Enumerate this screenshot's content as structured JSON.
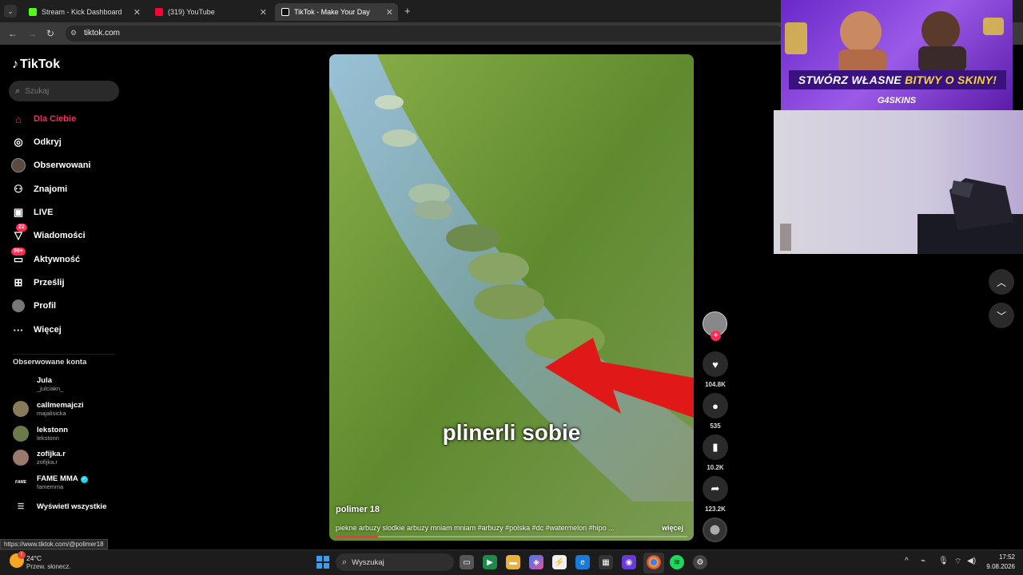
{
  "browser": {
    "tabs": [
      {
        "label": "Stream - Kick Dashboard",
        "color": "#53fc18"
      },
      {
        "label": "(319) YouTube",
        "color": "#ff0033"
      },
      {
        "label": "TikTok - Make Your Day",
        "color": "#ffffff"
      }
    ],
    "url": "tiktok.com",
    "status_url": "https://www.tiktok.com/@polimer18"
  },
  "sidebar": {
    "logo": "TikTok",
    "search_placeholder": "Szukaj",
    "nav": [
      {
        "label": "Dla Ciebie",
        "icon": "home-icon"
      },
      {
        "label": "Odkryj",
        "icon": "compass-icon"
      },
      {
        "label": "Obserwowani",
        "icon": "avatar-icon"
      },
      {
        "label": "Znajomi",
        "icon": "friends-icon"
      },
      {
        "label": "LIVE",
        "icon": "live-icon"
      },
      {
        "label": "Wiadomości",
        "icon": "send-icon",
        "badge": "22"
      },
      {
        "label": "Aktywność",
        "icon": "inbox-icon",
        "badge": "99+"
      },
      {
        "label": "Prześlij",
        "icon": "upload-icon"
      },
      {
        "label": "Profil",
        "icon": "profile-icon"
      },
      {
        "label": "Więcej",
        "icon": "more-icon"
      }
    ],
    "followed_title": "Obserwowane konta",
    "accounts": [
      {
        "name": "Jula",
        "handle": "_julciakn_"
      },
      {
        "name": "callmemajczi",
        "handle": "majalisicka"
      },
      {
        "name": "lekstonn",
        "handle": "lekstonn"
      },
      {
        "name": "zofijka.r",
        "handle": "zofijka.r"
      },
      {
        "name": "FAME MMA",
        "handle": "famemma",
        "avatar_text": "FAME"
      }
    ],
    "see_all": "Wyświetl wszystkie"
  },
  "video": {
    "overlay_text": "plinerli sobie",
    "author": "polimer 18",
    "description": "piekne arbuzy slodkie arbuzy mniam mniam #arbuzy #polska #dc #watermelon #hipo ...",
    "more": "więcej",
    "progress": 0.12
  },
  "actions": {
    "likes": "104.8K",
    "comments": "535",
    "saves": "10.2K",
    "shares": "123.2K"
  },
  "ad": {
    "headline_part1": "STWÓRZ WŁASNE ",
    "headline_part2": "BITWY O SKINY!",
    "brand": "G4SKINS"
  },
  "taskbar": {
    "temperature": "24°C",
    "condition": "Przew. słonecz.",
    "search": "Wyszukaj",
    "time": "17:52",
    "date": "9.08.2026"
  }
}
